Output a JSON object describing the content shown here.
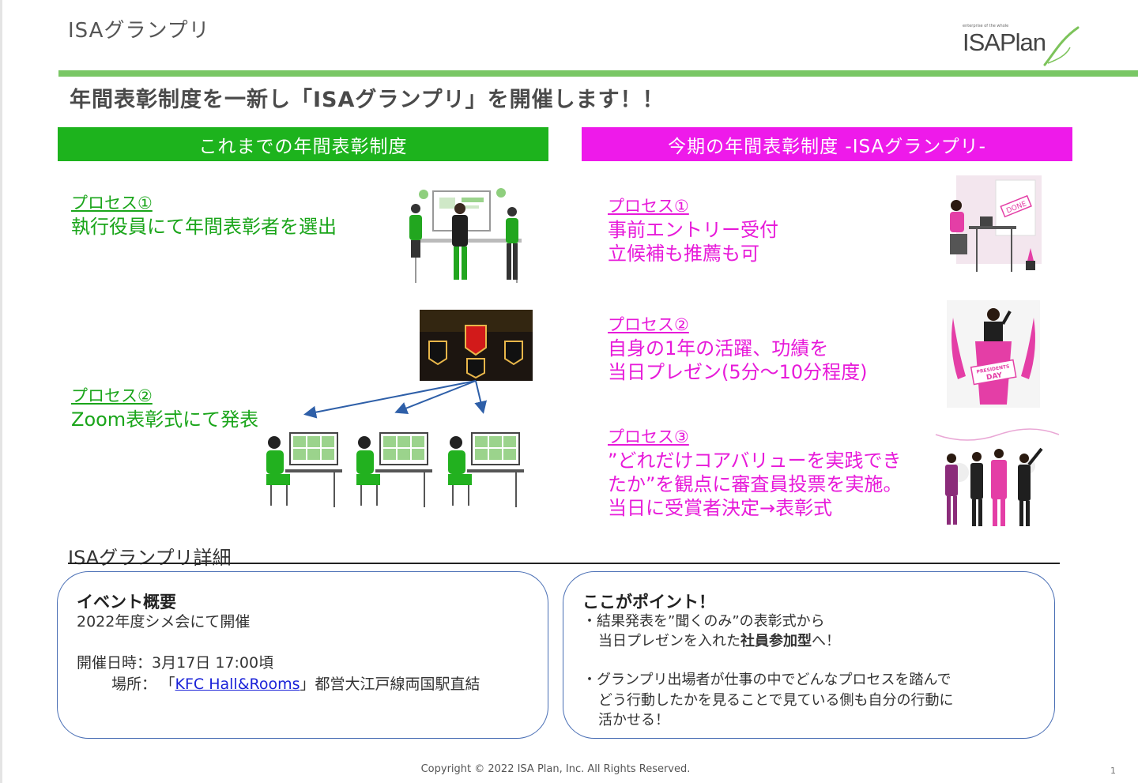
{
  "slide_title": "ISAグランプリ",
  "logo": {
    "small_text": "enterprise of the whole",
    "text": "ISAPlan"
  },
  "headline": "年間表彰制度を一新し「ISAグランプリ」を開催します！！",
  "columns": {
    "old": {
      "header": "これまでの年間表彰制度",
      "processes": [
        {
          "title": "プロセス①",
          "lines": [
            "執行役員にて年間表彰者を選出"
          ]
        },
        {
          "title": "プロセス②",
          "lines": [
            "Zoom表彰式にて発表"
          ]
        }
      ]
    },
    "new": {
      "header": "今期の年間表彰制度 -ISAグランプリ-",
      "processes": [
        {
          "title": "プロセス①",
          "lines": [
            "事前エントリー受付",
            "立候補も推薦も可"
          ]
        },
        {
          "title": "プロセス②",
          "lines": [
            "自身の1年の活躍、功績を",
            "当日プレゼン(5分〜10分程度)"
          ]
        },
        {
          "title": "プロセス③",
          "lines": [
            "”どれだけコアバリューを実践でき",
            "たか”を観点に審査員投票を実施。",
            "当日に受賞者決定→表彰式"
          ]
        }
      ]
    }
  },
  "illustrations": {
    "done_sign": "DONE",
    "presidents_day": [
      "PRESIDENTS",
      "DAY"
    ]
  },
  "details": {
    "heading": "ISAグランプリ詳細",
    "event": {
      "title": "イベント概要",
      "line1": "2022年度シメ会にて開催",
      "date_label": "開催日時：",
      "date_value": "3月17日 17:00頃",
      "place_label": "場所：",
      "place_open": "「",
      "place_link": "KFC Hall&Rooms",
      "place_rest": "」都営大江戸線両国駅直結"
    },
    "points": {
      "title": "ここがポイント！",
      "item1_line1": "・結果発表を”聞くのみ”の表彰式から",
      "item1_line2_pre": "当日プレゼンを入れた",
      "item1_line2_bold": "社員参加型",
      "item1_line2_post": "へ！",
      "item2_lines": [
        "・グランプリ出場者が仕事の中でどんなプロセスを踏んで",
        "どう行動したかを見ることで見ている側も自分の行動に",
        "活かせる！"
      ]
    }
  },
  "footer": {
    "copyright": "Copyright © 2022 ISA Plan, Inc. All Rights Reserved.",
    "page": "1"
  },
  "colors": {
    "green": "#1db31d",
    "magenta": "#ee1aea",
    "rule_green": "#79c765",
    "arrow_blue": "#2e5fa8"
  }
}
